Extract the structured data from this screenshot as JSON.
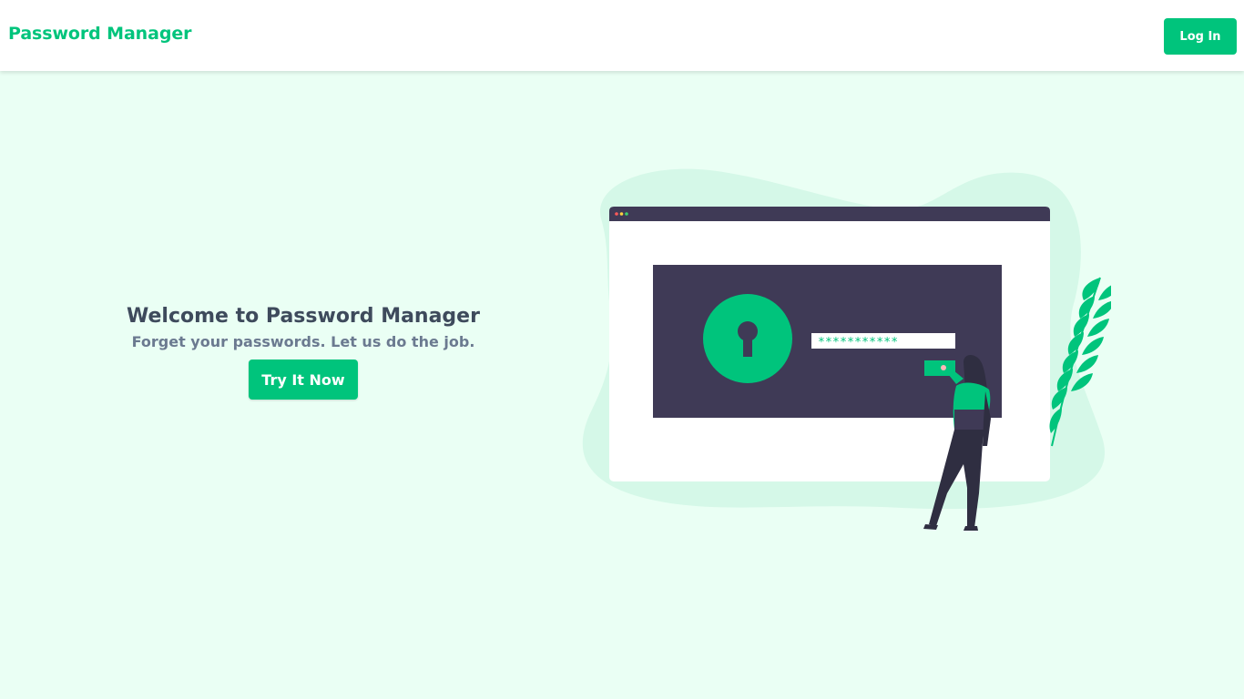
{
  "app": {
    "brand": "Password Manager"
  },
  "nav": {
    "login_label": "Log In"
  },
  "hero": {
    "title": "Welcome to Password Manager",
    "subtitle": "Forget your passwords. Let us do the job.",
    "cta_label": "Try It Now"
  },
  "illustration": {
    "password_mask": "***********",
    "icon": "keyhole-icon"
  },
  "colors": {
    "accent": "#00c47c",
    "background": "#eafff4",
    "blob": "#d5f8e8",
    "dark_panel": "#3f3a56",
    "title_text": "#3e4a5c",
    "subtitle_text": "#6b7a90"
  }
}
